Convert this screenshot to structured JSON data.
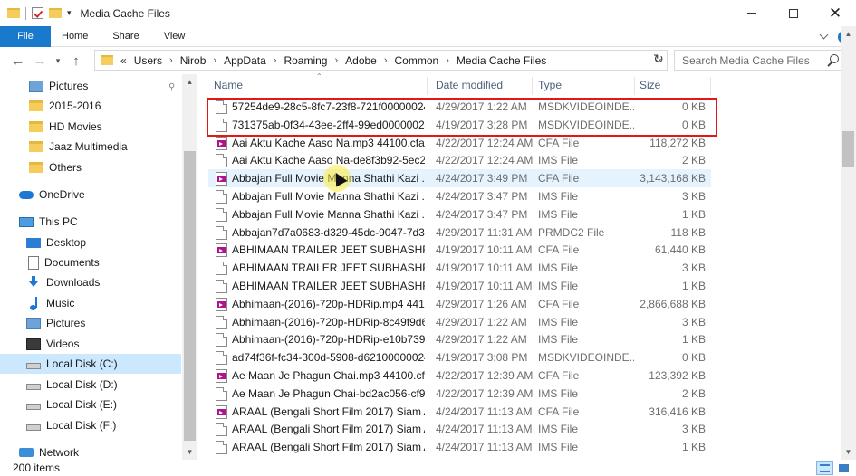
{
  "window": {
    "title": "Media Cache Files"
  },
  "ribbon": {
    "tabs": [
      "File",
      "Home",
      "Share",
      "View"
    ]
  },
  "address": {
    "prefix": "«",
    "breadcrumbs": [
      "Users",
      "Nirob",
      "AppData",
      "Roaming",
      "Adobe",
      "Common",
      "Media Cache Files"
    ]
  },
  "search": {
    "placeholder": "Search Media Cache Files"
  },
  "nav": {
    "items": [
      {
        "label": "Pictures",
        "icon": "pictures-icon",
        "pinned": true
      },
      {
        "label": "2015-2016",
        "icon": "folder-icon"
      },
      {
        "label": "HD Movies",
        "icon": "folder-icon"
      },
      {
        "label": "Jaaz Multimedia",
        "icon": "folder-icon"
      },
      {
        "label": "Others",
        "icon": "folder-icon"
      },
      {
        "label": "OneDrive",
        "icon": "onedrive-icon"
      },
      {
        "label": "This PC",
        "icon": "pc-icon"
      },
      {
        "label": "Desktop",
        "icon": "desktop-icon"
      },
      {
        "label": "Documents",
        "icon": "documents-icon"
      },
      {
        "label": "Downloads",
        "icon": "downloads-icon"
      },
      {
        "label": "Music",
        "icon": "music-icon"
      },
      {
        "label": "Pictures",
        "icon": "pictures-icon"
      },
      {
        "label": "Videos",
        "icon": "videos-icon"
      },
      {
        "label": "Local Disk (C:)",
        "icon": "disk-icon",
        "selected": true
      },
      {
        "label": "Local Disk (D:)",
        "icon": "disk-icon"
      },
      {
        "label": "Local Disk (E:)",
        "icon": "disk-icon"
      },
      {
        "label": "Local Disk (F:)",
        "icon": "disk-icon"
      },
      {
        "label": "Network",
        "icon": "network-icon"
      }
    ]
  },
  "columns": {
    "name": "Name",
    "date": "Date modified",
    "type": "Type",
    "size": "Size"
  },
  "files": [
    {
      "name": "57254de9-28c5-8fc7-23f8-721f00000024...",
      "date": "4/29/2017 1:22 AM",
      "type": "MSDKVIDEOINDE...",
      "size": "0 KB",
      "icon": "blank-file-icon"
    },
    {
      "name": "731375ab-0f34-43ee-2ff4-99ed00000024...",
      "date": "4/19/2017 3:28 PM",
      "type": "MSDKVIDEOINDE...",
      "size": "0 KB",
      "icon": "blank-file-icon"
    },
    {
      "name": "Aai Aktu Kache Aaso Na.mp3 44100.cfa",
      "date": "4/22/2017 12:24 AM",
      "type": "CFA File",
      "size": "118,272 KB",
      "icon": "media-file-icon"
    },
    {
      "name": "Aai Aktu Kache Aaso Na-de8f3b92-5ec2-...",
      "date": "4/22/2017 12:24 AM",
      "type": "IMS File",
      "size": "2 KB",
      "icon": "blank-file-icon"
    },
    {
      "name": "Abbajan  Full Movie  Manna  Shathi  Kazi ...",
      "date": "4/24/2017 3:49 PM",
      "type": "CFA File",
      "size": "3,143,168 KB",
      "icon": "media-file-icon"
    },
    {
      "name": "Abbajan  Full Movie  Manna  Shathi  Kazi ...",
      "date": "4/24/2017 3:47 PM",
      "type": "IMS File",
      "size": "3 KB",
      "icon": "blank-file-icon"
    },
    {
      "name": "Abbajan  Full Movie  Manna  Shathi  Kazi ...",
      "date": "4/24/2017 3:47 PM",
      "type": "IMS File",
      "size": "1 KB",
      "icon": "blank-file-icon"
    },
    {
      "name": "Abbajan7d7a0683-d329-45dc-9047-7d3a...",
      "date": "4/29/2017 11:31 AM",
      "type": "PRMDC2 File",
      "size": "118 KB",
      "icon": "blank-file-icon"
    },
    {
      "name": "ABHIMAAN TRAILER  JEET  SUBHASHREE...",
      "date": "4/19/2017 10:11 AM",
      "type": "CFA File",
      "size": "61,440 KB",
      "icon": "media-file-icon"
    },
    {
      "name": "ABHIMAAN TRAILER  JEET  SUBHASHREE...",
      "date": "4/19/2017 10:11 AM",
      "type": "IMS File",
      "size": "3 KB",
      "icon": "blank-file-icon"
    },
    {
      "name": "ABHIMAAN TRAILER  JEET  SUBHASHREE...",
      "date": "4/19/2017 10:11 AM",
      "type": "IMS File",
      "size": "1 KB",
      "icon": "blank-file-icon"
    },
    {
      "name": "Abhimaan-(2016)-720p-HDRip.mp4 4410...",
      "date": "4/29/2017 1:26 AM",
      "type": "CFA File",
      "size": "2,866,688 KB",
      "icon": "media-file-icon"
    },
    {
      "name": "Abhimaan-(2016)-720p-HDRip-8c49f9d6...",
      "date": "4/29/2017 1:22 AM",
      "type": "IMS File",
      "size": "3 KB",
      "icon": "blank-file-icon"
    },
    {
      "name": "Abhimaan-(2016)-720p-HDRip-e10b7395...",
      "date": "4/29/2017 1:22 AM",
      "type": "IMS File",
      "size": "1 KB",
      "icon": "blank-file-icon"
    },
    {
      "name": "ad74f36f-fc34-300d-5908-d62100000024...",
      "date": "4/19/2017 3:08 PM",
      "type": "MSDKVIDEOINDE...",
      "size": "0 KB",
      "icon": "blank-file-icon"
    },
    {
      "name": "Ae Maan Je Phagun Chai.mp3 44100.cfa",
      "date": "4/22/2017 12:39 AM",
      "type": "CFA File",
      "size": "123,392 KB",
      "icon": "media-file-icon"
    },
    {
      "name": "Ae Maan Je Phagun Chai-bd2ac056-cf97...",
      "date": "4/22/2017 12:39 AM",
      "type": "IMS File",
      "size": "2 KB",
      "icon": "blank-file-icon"
    },
    {
      "name": "ARAAL (Bengali Short Film 2017)  Siam A...",
      "date": "4/24/2017 11:13 AM",
      "type": "CFA File",
      "size": "316,416 KB",
      "icon": "media-file-icon"
    },
    {
      "name": "ARAAL (Bengali Short Film 2017)  Siam A...",
      "date": "4/24/2017 11:13 AM",
      "type": "IMS File",
      "size": "3 KB",
      "icon": "blank-file-icon"
    },
    {
      "name": "ARAAL (Bengali Short Film 2017)  Siam A...",
      "date": "4/24/2017 11:13 AM",
      "type": "IMS File",
      "size": "1 KB",
      "icon": "blank-file-icon"
    }
  ],
  "highlighted_row": 4,
  "status": {
    "count": "200 items"
  },
  "colors": {
    "accent": "#1979ca",
    "selection": "#cce8ff",
    "hover": "#e5f3ff",
    "annotation": "#e01818"
  }
}
